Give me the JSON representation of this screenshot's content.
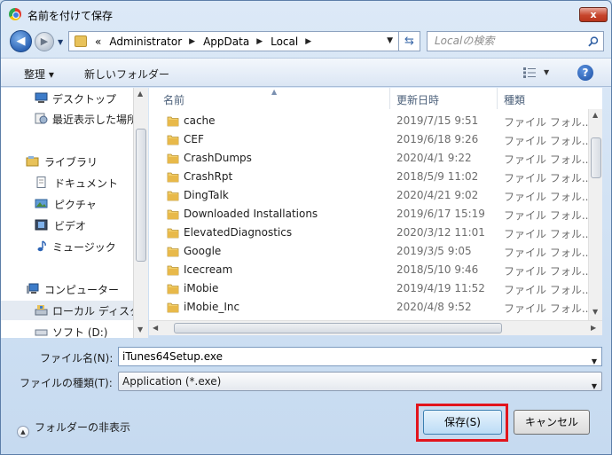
{
  "window": {
    "title": "名前を付けて保存",
    "close_glyph": "x"
  },
  "address": {
    "overflow": "«",
    "crumbs": [
      "Administrator",
      "AppData",
      "Local"
    ],
    "search_placeholder": "Localの検索"
  },
  "toolbar": {
    "organize": "整理 ▾",
    "new_folder": "新しいフォルダー",
    "help": "?"
  },
  "nav": {
    "items": [
      {
        "label": "デスクトップ",
        "icon": "desktop-icon"
      },
      {
        "label": "最近表示した場所",
        "icon": "recent-places-icon"
      },
      {
        "label": "ライブラリ",
        "icon": "library-icon"
      },
      {
        "label": "ドキュメント",
        "icon": "documents-icon"
      },
      {
        "label": "ピクチャ",
        "icon": "pictures-icon"
      },
      {
        "label": "ビデオ",
        "icon": "videos-icon"
      },
      {
        "label": "ミュージック",
        "icon": "music-icon"
      },
      {
        "label": "コンピューター",
        "icon": "computer-icon"
      },
      {
        "label": "ローカル ディスク",
        "icon": "local-disk-icon"
      },
      {
        "label": "ソフト (D:)",
        "icon": "drive-icon"
      }
    ]
  },
  "columns": {
    "name": "名前",
    "date": "更新日時",
    "type": "種類"
  },
  "files": [
    {
      "name": "cache",
      "date": "2019/7/15 9:51",
      "type": "ファイル フォル..."
    },
    {
      "name": "CEF",
      "date": "2019/6/18 9:26",
      "type": "ファイル フォル..."
    },
    {
      "name": "CrashDumps",
      "date": "2020/4/1 9:22",
      "type": "ファイル フォル..."
    },
    {
      "name": "CrashRpt",
      "date": "2018/5/9 11:02",
      "type": "ファイル フォル..."
    },
    {
      "name": "DingTalk",
      "date": "2020/4/21 9:02",
      "type": "ファイル フォル..."
    },
    {
      "name": "Downloaded Installations",
      "date": "2019/6/17 15:19",
      "type": "ファイル フォル..."
    },
    {
      "name": "ElevatedDiagnostics",
      "date": "2020/3/12 11:01",
      "type": "ファイル フォル..."
    },
    {
      "name": "Google",
      "date": "2019/3/5 9:05",
      "type": "ファイル フォル..."
    },
    {
      "name": "Icecream",
      "date": "2018/5/10 9:46",
      "type": "ファイル フォル..."
    },
    {
      "name": "iMobie",
      "date": "2019/4/19 11:52",
      "type": "ファイル フォル..."
    },
    {
      "name": "iMobie_Inc",
      "date": "2020/4/8 9:52",
      "type": "ファイル フォル..."
    }
  ],
  "form": {
    "filename_label": "ファイル名(N):",
    "filename_value": "iTunes64Setup.exe",
    "filetype_label": "ファイルの種類(T):",
    "filetype_value": "Application (*.exe)"
  },
  "footer": {
    "hide_folders": "フォルダーの非表示",
    "save": "保存(S)",
    "cancel": "キャンセル"
  },
  "colors": {
    "highlight": "#e2141c",
    "folder": "#e8c25a"
  }
}
